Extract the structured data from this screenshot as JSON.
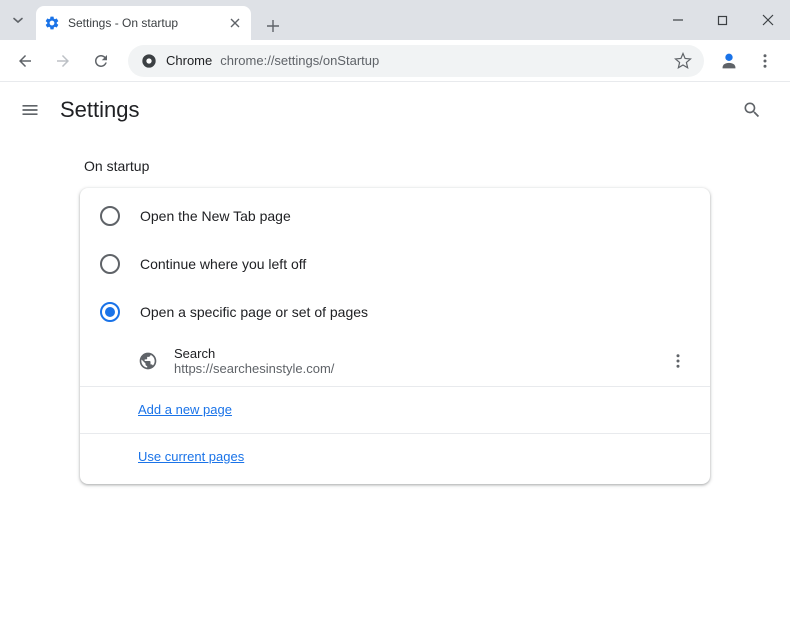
{
  "tab": {
    "title": "Settings - On startup"
  },
  "omnibox": {
    "scheme_label": "Chrome",
    "url": "chrome://settings/onStartup"
  },
  "settings": {
    "header_title": "Settings",
    "section_title": "On startup",
    "options": [
      {
        "label": "Open the New Tab page",
        "selected": false
      },
      {
        "label": "Continue where you left off",
        "selected": false
      },
      {
        "label": "Open a specific page or set of pages",
        "selected": true
      }
    ],
    "startup_page": {
      "title": "Search",
      "url": "https://searchesinstyle.com/"
    },
    "add_page_label": "Add a new page",
    "use_current_label": "Use current pages"
  }
}
